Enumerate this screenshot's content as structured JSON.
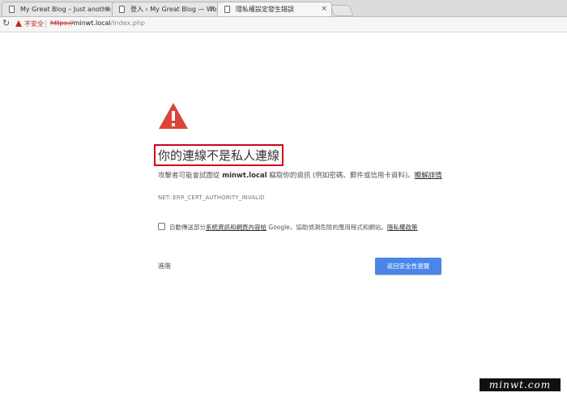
{
  "tabs": [
    {
      "title": "My Great Blog – Just another W",
      "active": false
    },
    {
      "title": "登入 ‹ My Great Blog — WordP",
      "active": false
    },
    {
      "title": "隱私權設定發生錯誤",
      "active": true
    }
  ],
  "tab_close_glyph": "×",
  "omnibox": {
    "security_label": "不安全",
    "scheme": "https://",
    "host": "minwt.local",
    "path": "/index.php"
  },
  "interstitial": {
    "heading": "你的連線不是私人連線",
    "body_prefix": "攻擊者可能會試圖從",
    "body_host": "minwt.local",
    "body_suffix": "竊取你的資訊 (例如密碼、郵件或信用卡資料)。",
    "learn_more": "瞭解詳情",
    "error_code": "NET::ERR_CERT_AUTHORITY_INVALID",
    "checkbox_prefix": "自動傳送部分",
    "checkbox_link": "系統資訊和網頁內容給",
    "checkbox_middle": " Google，協助偵測危險的應用程式和網站。",
    "privacy_link": "隱私權政策",
    "advanced_label": "進階",
    "back_button": "返回安全性瀏覽"
  },
  "watermark": "minwt.com",
  "colors": {
    "danger": "#db4437",
    "primary_button": "#4a86e8",
    "highlight_box": "#d0021b"
  },
  "icons": [
    "document-icon",
    "reload-icon",
    "warning-icon",
    "large-warning-icon",
    "checkbox-icon"
  ]
}
